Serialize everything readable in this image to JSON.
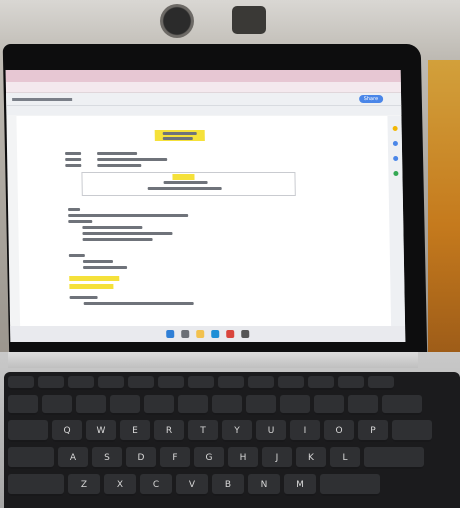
{
  "toolbar": {
    "share_label": "Share"
  },
  "keyboard": {
    "rows": [
      [
        "",
        "",
        "",
        "",
        "",
        "",
        "",
        "",
        "",
        "",
        "",
        "",
        ""
      ],
      [
        "",
        "",
        "",
        "",
        "",
        "",
        "",
        "",
        "",
        "",
        "",
        ""
      ],
      [
        "",
        "Q",
        "W",
        "E",
        "R",
        "T",
        "Y",
        "U",
        "I",
        "O",
        "P",
        ""
      ],
      [
        "",
        "A",
        "S",
        "D",
        "F",
        "G",
        "H",
        "J",
        "K",
        "L",
        ""
      ],
      [
        "",
        "Z",
        "X",
        "C",
        "V",
        "B",
        "N",
        "M",
        ""
      ]
    ]
  },
  "colors": {
    "screen_bg": "#f3f4f5",
    "highlight": "#f5e13a",
    "tab_bar": "#e7c7d3",
    "share_button": "#4a86e8",
    "key": "#2f3033"
  }
}
